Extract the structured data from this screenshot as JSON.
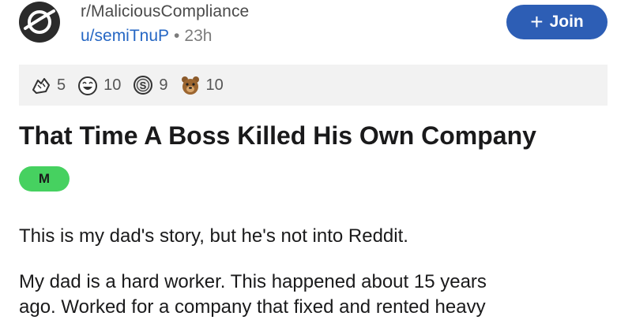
{
  "post": {
    "subreddit": "r/MaliciousCompliance",
    "username": "u/semiTnuP",
    "separator": "•",
    "age": "23h",
    "title": "That Time A Boss Killed His Own Company",
    "flair": "M",
    "paragraphs": [
      [
        "This is my dad's story, but he's not into Reddit."
      ],
      [
        "My dad is a hard worker. This happened about 15 years",
        "ago. Worked for a company that fixed and rented heavy"
      ]
    ]
  },
  "join_button": {
    "label": "Join",
    "icon": "plus-icon"
  },
  "awards": [
    {
      "icon": "hands-award-icon",
      "count": "5"
    },
    {
      "icon": "laughing-face-award-icon",
      "count": "10"
    },
    {
      "icon": "silver-coin-award-icon",
      "count": "9"
    },
    {
      "icon": "bear-award-icon",
      "count": "10"
    }
  ],
  "colors": {
    "join_button": "#2d5eb5",
    "flair": "#46d160",
    "username": "#2667c4",
    "awards_bar": "#f2f2f2"
  }
}
